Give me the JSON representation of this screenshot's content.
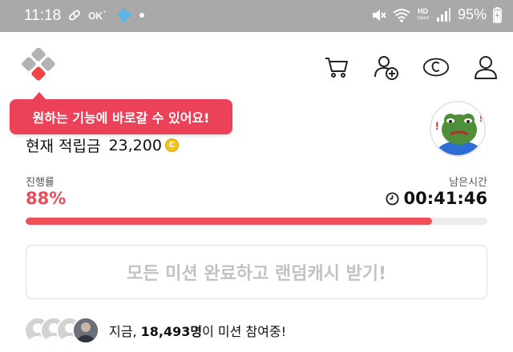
{
  "status_bar": {
    "time": "11:18",
    "battery": "95%",
    "hd_label": "HD",
    "hd_sub": "Voice",
    "icons": [
      "pill-icon",
      "ok-cashbag-icon",
      "medical-cross-icon",
      "dot-icon",
      "mute-icon",
      "wifi-icon",
      "signal-icon",
      "battery-charging-icon"
    ]
  },
  "header": {
    "logo": "four-squares-logo",
    "icons": [
      "cart-icon",
      "add-friend-icon",
      "cash-icon",
      "profile-icon"
    ]
  },
  "tooltip": {
    "text": "원하는 기능에 바로갈 수 있어요!"
  },
  "points": {
    "label": "현재 적립금",
    "value": "23,200",
    "coin_symbol": "C"
  },
  "progress": {
    "label": "진행률",
    "value_text": "88%",
    "fraction": 0.88
  },
  "remaining": {
    "label": "남은시간",
    "value": "00:41:46"
  },
  "cta": {
    "label": "모든 미션 완료하고 랜덤캐시 받기!"
  },
  "participants": {
    "prefix": "지금, ",
    "count": "18,493명",
    "suffix": "이 미션 참여중!"
  },
  "colors": {
    "accent": "#ec4259",
    "progress_fill": "#ef4f56",
    "progress_text": "#ea4c5c",
    "coin": "#f2c21e",
    "status_bar": "#a9a9a9"
  }
}
